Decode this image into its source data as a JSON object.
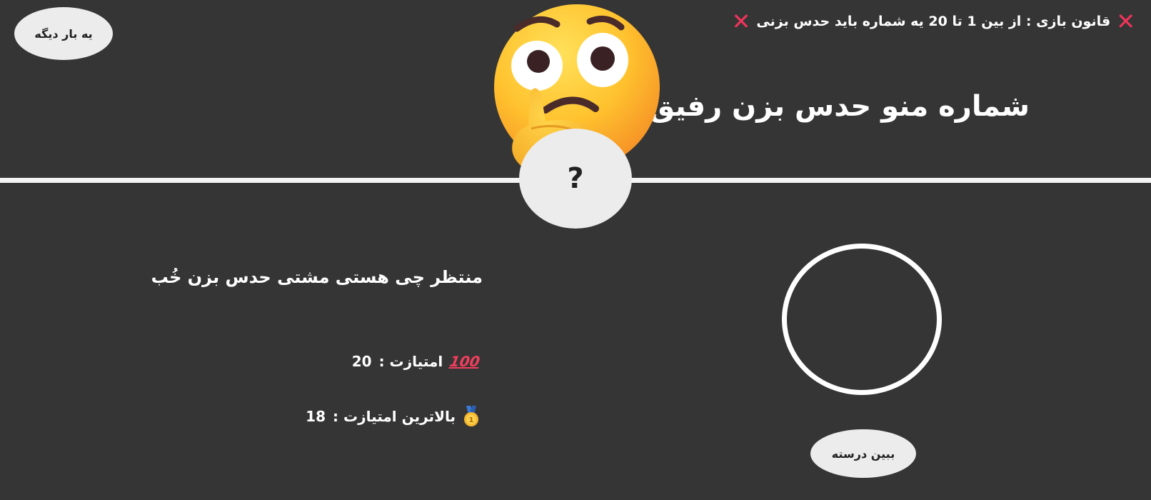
{
  "header": {
    "again_label": "یه بار دیگه",
    "rule_text": "قانون بازی : از بین 1 تا 20 یه شماره باید حدس بزنی",
    "title": "شماره منو حدس بزن رفیق",
    "emoji_icon": "thinking-face-icon"
  },
  "game": {
    "secret_number": "?",
    "status_message": "منتظر چی هستی مشتی حدس بزن خُب",
    "score_label": "امتیازت :",
    "score_value": "20",
    "score_icon_text": "100",
    "highscore_label": "بالاترین امتیازت :",
    "highscore_value": "18",
    "highscore_icon": "medal-icon",
    "guess_value": "",
    "check_label": "ببین درسته"
  },
  "colors": {
    "background": "#363535",
    "accent_x": "#f0345a",
    "button_bg": "#ececec",
    "divider": "#f4f4f4"
  }
}
